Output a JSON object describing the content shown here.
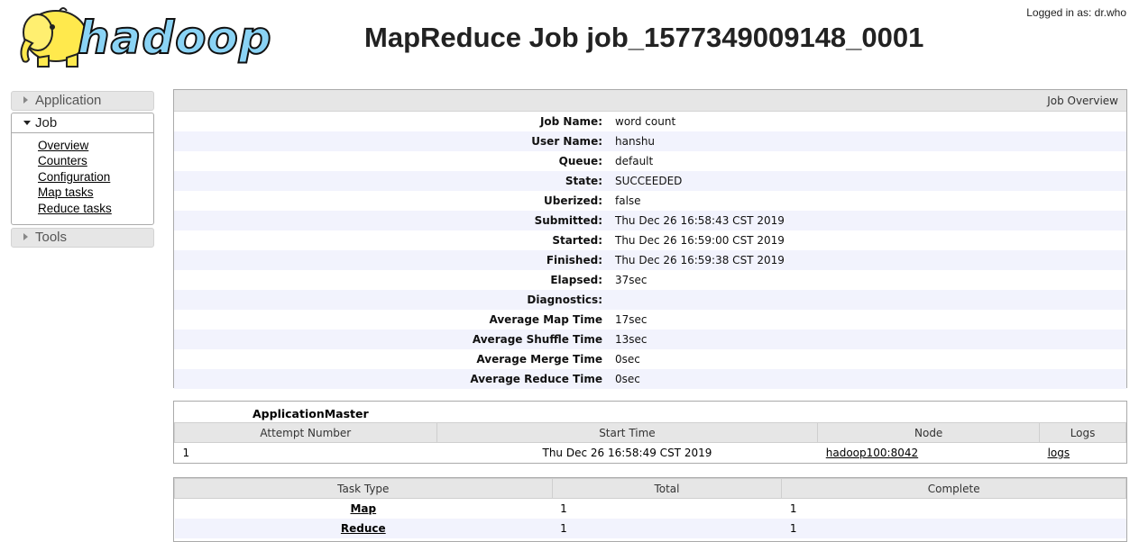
{
  "header": {
    "logo_text": "hadoop",
    "title": "MapReduce Job job_1577349009148_0001",
    "logged_in": "Logged in as: dr.who"
  },
  "sidebar": {
    "application_label": "Application",
    "job_label": "Job",
    "job_links": [
      "Overview",
      "Counters",
      "Configuration",
      "Map tasks",
      "Reduce tasks"
    ],
    "tools_label": "Tools"
  },
  "overview": {
    "header": "Job Overview",
    "rows": [
      {
        "key": "Job Name:",
        "value": "word count"
      },
      {
        "key": "User Name:",
        "value": "hanshu"
      },
      {
        "key": "Queue:",
        "value": "default"
      },
      {
        "key": "State:",
        "value": "SUCCEEDED"
      },
      {
        "key": "Uberized:",
        "value": "false"
      },
      {
        "key": "Submitted:",
        "value": "Thu Dec 26 16:58:43 CST 2019"
      },
      {
        "key": "Started:",
        "value": "Thu Dec 26 16:59:00 CST 2019"
      },
      {
        "key": "Finished:",
        "value": "Thu Dec 26 16:59:38 CST 2019"
      },
      {
        "key": "Elapsed:",
        "value": "37sec"
      },
      {
        "key": "Diagnostics:",
        "value": ""
      },
      {
        "key": "Average Map Time",
        "value": "17sec"
      },
      {
        "key": "Average Shuffle Time",
        "value": "13sec"
      },
      {
        "key": "Average Merge Time",
        "value": "0sec"
      },
      {
        "key": "Average Reduce Time",
        "value": "0sec"
      }
    ]
  },
  "app_master": {
    "caption": "ApplicationMaster",
    "columns": [
      "Attempt Number",
      "Start Time",
      "Node",
      "Logs"
    ],
    "rows": [
      {
        "attempt": "1",
        "start_time": "Thu Dec 26 16:58:49 CST 2019",
        "node": "hadoop100:8042",
        "logs": "logs"
      }
    ]
  },
  "tasks": {
    "columns": [
      "Task Type",
      "Total",
      "Complete"
    ],
    "rows": [
      {
        "type": "Map",
        "total": "1",
        "complete": "1"
      },
      {
        "type": "Reduce",
        "total": "1",
        "complete": "1"
      }
    ]
  }
}
